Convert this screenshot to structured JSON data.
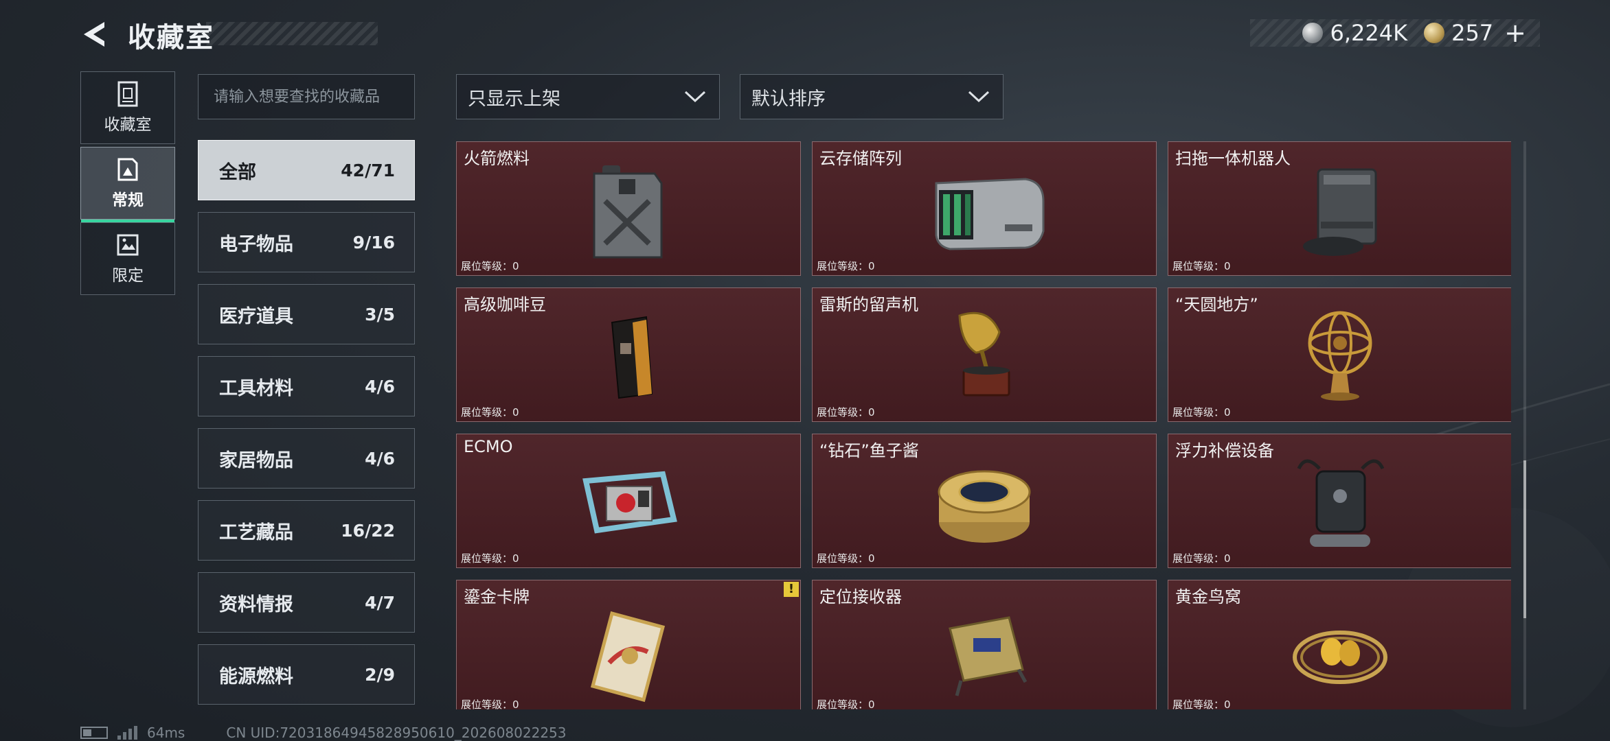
{
  "header": {
    "title": "收藏室",
    "currencies": [
      {
        "icon": "silver-coin-icon",
        "value": "6,224K"
      },
      {
        "icon": "gold-coin-icon",
        "value": "257"
      }
    ],
    "plus_label": "+"
  },
  "leftnav": [
    {
      "label": "收藏室",
      "icon": "collection-icon"
    },
    {
      "label": "常规",
      "icon": "regular-icon",
      "active": true
    },
    {
      "label": "限定",
      "icon": "limited-icon"
    }
  ],
  "search": {
    "placeholder": "请输入想要查找的收藏品"
  },
  "categories": [
    {
      "name": "全部",
      "count": "42/71",
      "active": true
    },
    {
      "name": "电子物品",
      "count": "9/16"
    },
    {
      "name": "医疗道具",
      "count": "3/5"
    },
    {
      "name": "工具材料",
      "count": "4/6"
    },
    {
      "name": "家居物品",
      "count": "4/6"
    },
    {
      "name": "工艺藏品",
      "count": "16/22"
    },
    {
      "name": "资料情报",
      "count": "4/7"
    },
    {
      "name": "能源燃料",
      "count": "2/9"
    }
  ],
  "filters": {
    "show": "只显示上架",
    "sort": "默认排序"
  },
  "items": [
    {
      "name": "火箭燃料",
      "level": "展位等级：0",
      "icon": "jerrycan-icon"
    },
    {
      "name": "云存储阵列",
      "level": "展位等级：0",
      "icon": "server-array-icon"
    },
    {
      "name": "扫拖一体机器人",
      "level": "展位等级：0",
      "icon": "robot-vacuum-icon"
    },
    {
      "name": "高级咖啡豆",
      "level": "展位等级：0",
      "icon": "coffee-bag-icon"
    },
    {
      "name": "雷斯的留声机",
      "level": "展位等级：0",
      "icon": "gramophone-icon"
    },
    {
      "name": "“天圆地方”",
      "level": "展位等级：0",
      "icon": "armillary-sphere-icon"
    },
    {
      "name": "ECMO",
      "level": "展位等级：0",
      "icon": "ecmo-machine-icon"
    },
    {
      "name": "“钻石”鱼子酱",
      "level": "展位等级：0",
      "icon": "caviar-tin-icon"
    },
    {
      "name": "浮力补偿设备",
      "level": "展位等级：0",
      "icon": "diving-gear-icon"
    },
    {
      "name": "鎏金卡牌",
      "level": "展位等级：0",
      "icon": "gilded-card-icon",
      "warning": "!"
    },
    {
      "name": "定位接收器",
      "level": "展位等级：0",
      "icon": "gps-receiver-icon"
    },
    {
      "name": "黄金鸟窝",
      "level": "展位等级：0",
      "icon": "golden-nest-icon"
    }
  ],
  "status": {
    "ping": "64ms",
    "uid": "CN UID:72031864945828950610_202608022253"
  },
  "colors": {
    "card_bg": "#4a1f24",
    "accent_green": "#39d5a0",
    "warn_yellow": "#e6c83a"
  }
}
